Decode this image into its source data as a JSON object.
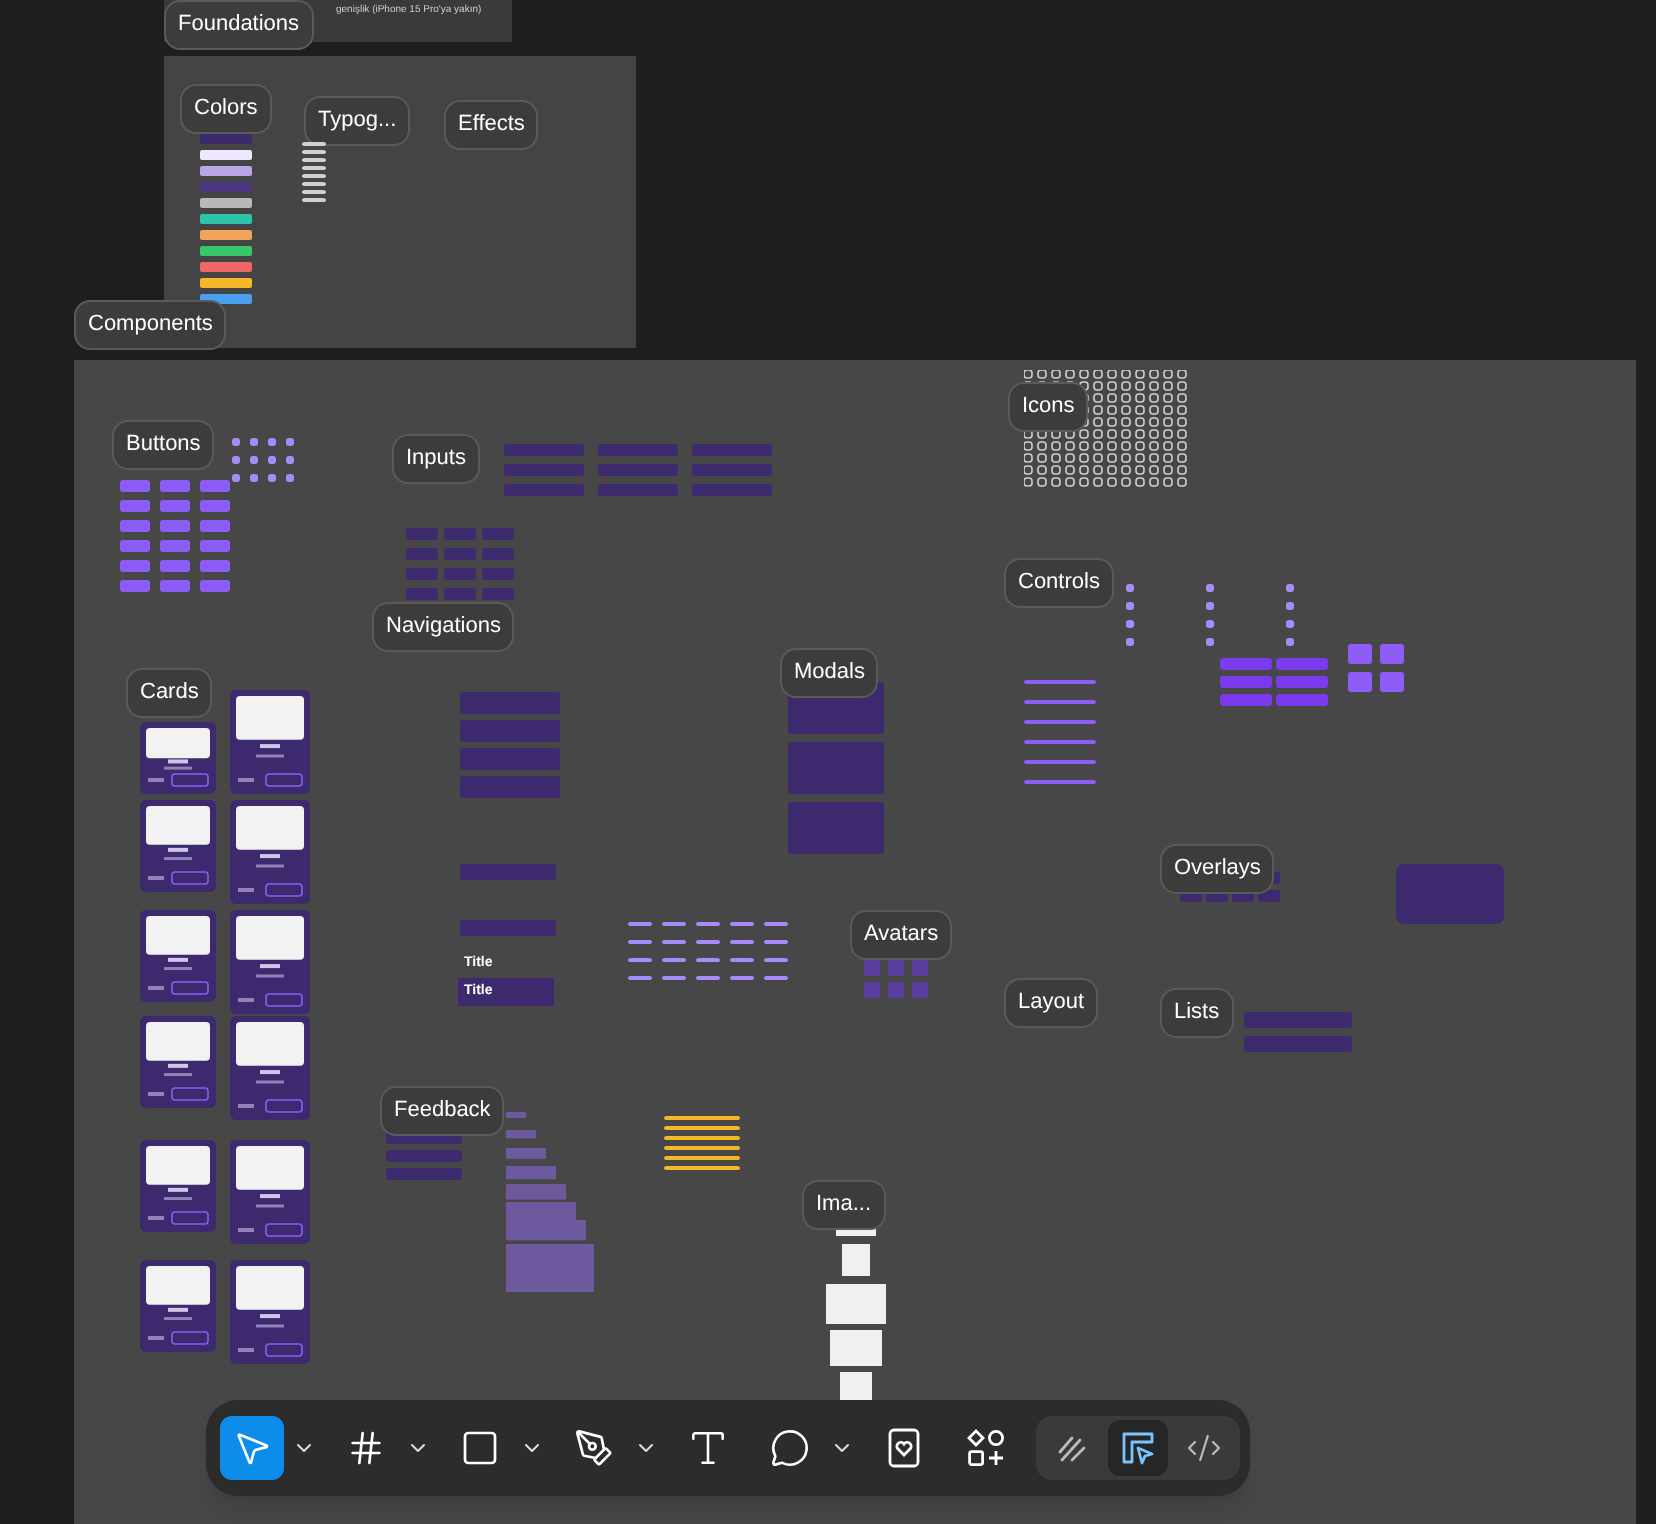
{
  "top_note": "genişlik (iPhone 15 Pro'ya yakın)",
  "foundations": {
    "label": "Foundations",
    "sections": [
      {
        "label": "Colors"
      },
      {
        "label": "Typog..."
      },
      {
        "label": "Effects"
      }
    ],
    "swatches": [
      {
        "color": "#3b2a6b"
      },
      {
        "color": "#efe7ff"
      },
      {
        "color": "#b9a6e6"
      },
      {
        "color": "#4a3580"
      },
      {
        "color": "#b8b8b8"
      },
      {
        "color": "#2ec4a9"
      },
      {
        "color": "#f4a35a"
      },
      {
        "color": "#37c86a"
      },
      {
        "color": "#f06565"
      },
      {
        "color": "#f5b82a"
      },
      {
        "color": "#4a9ff0"
      }
    ]
  },
  "components": {
    "label": "Components",
    "sections": [
      {
        "label": "Buttons"
      },
      {
        "label": "Inputs"
      },
      {
        "label": "Icons"
      },
      {
        "label": "Controls"
      },
      {
        "label": "Navigations"
      },
      {
        "label": "Cards"
      },
      {
        "label": "Modals"
      },
      {
        "label": "Overlays"
      },
      {
        "label": "Avatars"
      },
      {
        "label": "Layout"
      },
      {
        "label": "Lists"
      },
      {
        "label": "Feedback"
      },
      {
        "label": "Ima..."
      }
    ],
    "nav_titles": [
      "Title",
      "Title"
    ]
  },
  "toolbar": {
    "tools": [
      {
        "selected": true,
        "has_menu": true
      },
      {
        "selected": false,
        "has_menu": true
      },
      {
        "selected": false,
        "has_menu": true
      },
      {
        "selected": false,
        "has_menu": true
      },
      {
        "selected": false,
        "has_menu": false
      },
      {
        "selected": false,
        "has_menu": true
      },
      {
        "selected": false,
        "has_menu": false
      },
      {
        "selected": false,
        "has_menu": false
      }
    ],
    "modes": [
      {
        "selected": false
      },
      {
        "selected": true
      },
      {
        "selected": false
      }
    ]
  }
}
